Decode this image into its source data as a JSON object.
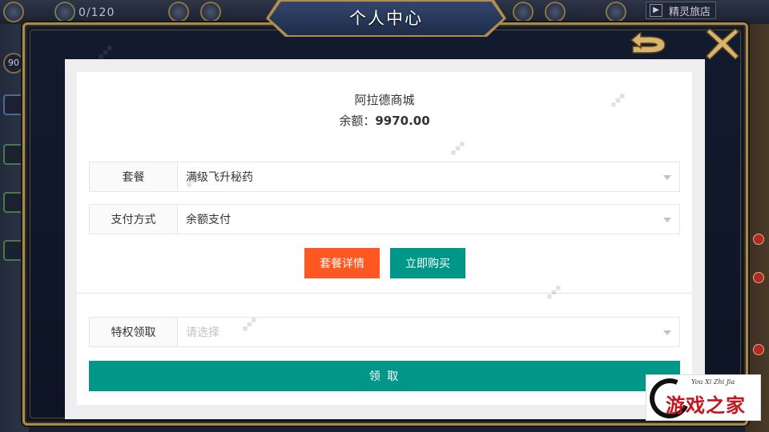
{
  "hud": {
    "counter": "0/120",
    "level": "90",
    "shop_label": "精灵旅店"
  },
  "modal": {
    "title": "个人中心"
  },
  "shop": {
    "name": "阿拉德商城",
    "balance_label": "余额：",
    "balance_value": "9970.00"
  },
  "purchase_form": {
    "package_label": "套餐",
    "package_value": "满级飞升秘药",
    "payment_label": "支付方式",
    "payment_value": "余额支付",
    "details_button": "套餐详情",
    "buy_button": "立即购买"
  },
  "privilege_form": {
    "label": "特权领取",
    "placeholder": "请选择",
    "claim_button": "领 取"
  },
  "colors": {
    "orange_button": "#ff5722",
    "teal_button": "#009688",
    "frame_gold": "#a78a52",
    "frame_navy": "#121b2e"
  },
  "icons": {
    "back": "back-arrow-icon",
    "close": "close-x-icon",
    "dropdown": "chevron-down-icon"
  }
}
